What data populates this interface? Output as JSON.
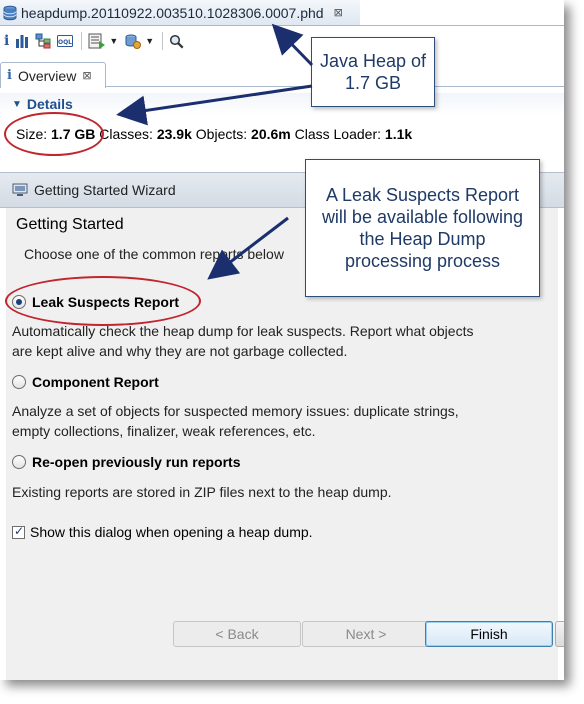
{
  "editor": {
    "file_tab_title": "heapdump.20110922.003510.1028306.0007.phd",
    "close_glyph": "⊠"
  },
  "toolbar": {
    "icons": [
      "info-icon",
      "histogram-icon",
      "dominator-tree-icon",
      "oql-icon",
      "run-report-icon",
      "query-browser-icon",
      "search-icon"
    ]
  },
  "overview": {
    "tab_label": "Overview",
    "details_label": "Details",
    "size_label": "Size:",
    "size_value": "1.7 GB",
    "classes_label": "Classes:",
    "classes_value": "23.9k",
    "objects_label": "Objects:",
    "objects_value": "20.6m",
    "class_loader_label": "Class Loader:",
    "class_loader_value": "1.1k"
  },
  "wizard": {
    "title": "Getting Started Wizard",
    "heading": "Getting Started",
    "subtitle": "Choose one of the common reports below",
    "options": [
      {
        "label": "Leak Suspects Report",
        "selected": true,
        "description": "Automatically check the heap dump for leak suspects. Report what objects are kept alive and why they are not garbage collected."
      },
      {
        "label": "Component Report",
        "selected": false,
        "description": "Analyze a set of objects for suspected memory issues: duplicate strings, empty collections, finalizer, weak references, etc."
      },
      {
        "label": "Re-open previously run reports",
        "selected": false,
        "description": "Existing reports are stored in ZIP files next to the heap dump."
      }
    ],
    "show_dialog_label": "Show this dialog when opening a heap dump.",
    "show_dialog_checked": true,
    "buttons": {
      "back": "< Back",
      "next": "Next >",
      "finish": "Finish"
    }
  },
  "annotations": {
    "java_heap": "Java Heap of 1.7 GB",
    "leak_suspects": "A Leak Suspects Report will be available following the Heap Dump processing process"
  },
  "colors": {
    "accent_blue": "#1f4f8c",
    "annotation_red": "#c0262d",
    "arrow_navy": "#1b2f6e"
  }
}
